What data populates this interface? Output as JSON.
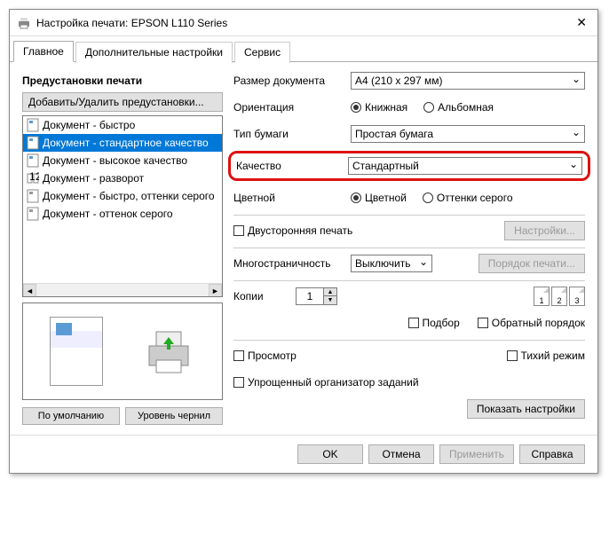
{
  "window": {
    "title": "Настройка печати: EPSON L110 Series"
  },
  "tabs": {
    "main": "Главное",
    "advanced": "Дополнительные настройки",
    "service": "Сервис"
  },
  "left": {
    "presets_title": "Предустановки печати",
    "add_remove": "Добавить/Удалить предустановки...",
    "items": [
      "Документ - быстро",
      "Документ - стандартное качество",
      "Документ - высокое качество",
      "Документ - разворот",
      "Документ - быстро, оттенки серого",
      "Документ - оттенок серого"
    ],
    "defaults_btn": "По умолчанию",
    "ink_btn": "Уровень чернил"
  },
  "right": {
    "doc_size_label": "Размер документа",
    "doc_size_value": "A4 (210 x 297 мм)",
    "orient_label": "Ориентация",
    "orient_portrait": "Книжная",
    "orient_landscape": "Альбомная",
    "paper_label": "Тип бумаги",
    "paper_value": "Простая бумага",
    "quality_label": "Качество",
    "quality_value": "Стандартный",
    "color_label": "Цветной",
    "color_color": "Цветной",
    "color_gray": "Оттенки серого",
    "duplex": "Двусторонняя печать",
    "settings_btn": "Настройки...",
    "multipage_label": "Многостраничность",
    "multipage_value": "Выключить",
    "page_order_btn": "Порядок печати...",
    "copies_label": "Копии",
    "copies_value": "1",
    "collate": "Подбор",
    "reverse": "Обратный порядок",
    "preview": "Просмотр",
    "quiet": "Тихий режим",
    "simple_org": "Упрощенный организатор заданий",
    "show_settings": "Показать настройки",
    "collate_nums": [
      "1",
      "2",
      "3"
    ]
  },
  "dialog": {
    "ok": "OK",
    "cancel": "Отмена",
    "apply": "Применить",
    "help": "Справка"
  }
}
